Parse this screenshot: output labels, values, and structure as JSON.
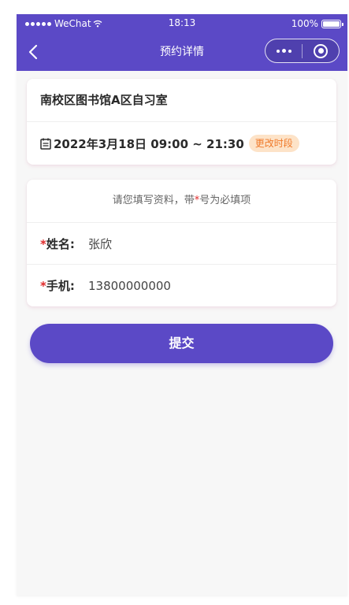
{
  "status_bar": {
    "carrier": "WeChat",
    "time": "18:13",
    "battery": "100%",
    "battery_level": 1.0
  },
  "nav": {
    "title": "预约详情",
    "back_icon": "chevron-left-icon",
    "more_icon": "more-dots-icon",
    "close_icon": "target-close-icon"
  },
  "booking": {
    "room_name": "南校区图书馆A区自习室",
    "calendar_icon": "calendar-icon",
    "datetime": "2022年3月18日 09:00 ~ 21:30",
    "change_label": "更改时段"
  },
  "form": {
    "tip_before": "请您填写资料，带",
    "tip_star": "*",
    "tip_after": "号为必填项",
    "fields": [
      {
        "star": "*",
        "label": "姓名:",
        "value": "张欣"
      },
      {
        "star": "*",
        "label": "手机:",
        "value": "13800000000"
      }
    ]
  },
  "submit_label": "提交",
  "colors": {
    "primary": "#5b49c6",
    "badge_bg": "#fde3c8",
    "badge_text": "#f07a2a",
    "required": "#e02b2b",
    "page_bg": "#f7f7f7"
  }
}
